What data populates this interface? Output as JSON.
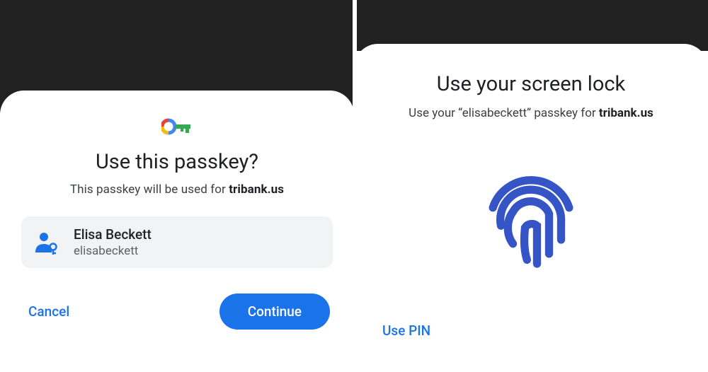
{
  "left": {
    "heading": "Use this passkey?",
    "subtext_prefix": "This passkey will be used for ",
    "domain": "tribank.us",
    "account": {
      "name": "Elisa Beckett",
      "username": "elisabeckett"
    },
    "cancel_label": "Cancel",
    "continue_label": "Continue"
  },
  "right": {
    "heading": "Use your screen lock",
    "subtext_prefix": "Use your ",
    "subtext_quoted": "“elisabeckett”",
    "subtext_mid": " passkey for ",
    "domain": "tribank.us",
    "use_pin_label": "Use PIN"
  },
  "colors": {
    "primary": "#1a73e8",
    "fingerprint": "#3555c6"
  }
}
